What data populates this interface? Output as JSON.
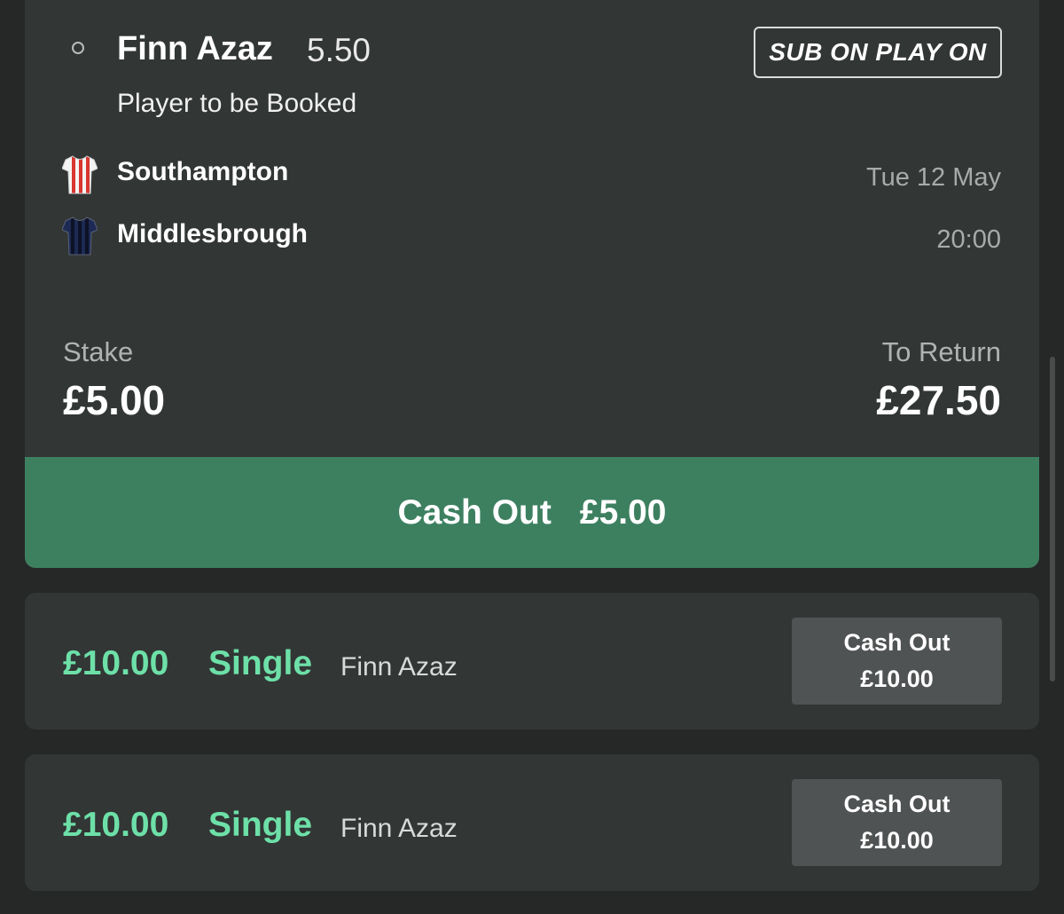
{
  "bet": {
    "selection": "Finn Azaz",
    "odds": "5.50",
    "badge": "SUB ON PLAY ON",
    "market": "Player to be Booked",
    "home_team": "Southampton",
    "away_team": "Middlesbrough",
    "date": "Tue 12 May",
    "time": "20:00",
    "stake_label": "Stake",
    "stake": "£5.00",
    "return_label": "To Return",
    "return": "£27.50",
    "cashout_label": "Cash Out",
    "cashout_value": "£5.00"
  },
  "singles": [
    {
      "amount": "£10.00",
      "type": "Single",
      "name": "Finn Azaz",
      "cashout_label": "Cash Out",
      "cashout_value": "£10.00"
    },
    {
      "amount": "£10.00",
      "type": "Single",
      "name": "Finn Azaz",
      "cashout_label": "Cash Out",
      "cashout_value": "£10.00"
    }
  ],
  "colors": {
    "background": "#262828",
    "card": "#323635",
    "cashout_green": "#3d8060",
    "accent_green": "#6de0a8",
    "cashout_button": "#505353"
  },
  "icons": {
    "home_shirt": "red-white-striped-shirt-icon",
    "away_shirt": "navy-striped-shirt-icon",
    "radio": "radio-unselected-icon"
  }
}
